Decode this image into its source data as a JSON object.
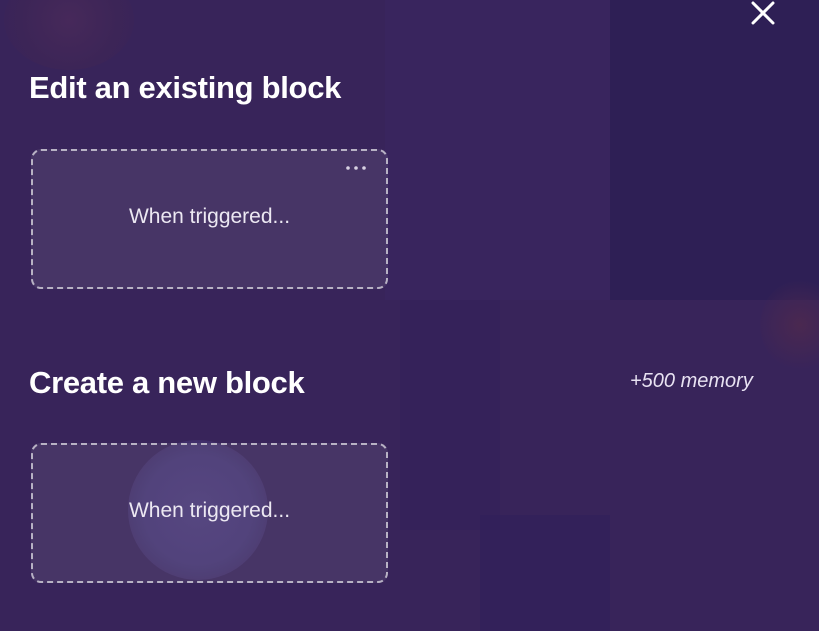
{
  "dialog": {
    "close_icon": "close-icon"
  },
  "edit_section": {
    "title": "Edit an existing block",
    "card_text": "When triggered...",
    "more_icon": "more-horizontal-icon"
  },
  "create_section": {
    "title": "Create a new block",
    "memory_note": "+500 memory",
    "card_text": "When triggered..."
  },
  "colors": {
    "background": "#38245a",
    "card_border": "#b8b2c4",
    "text": "#ffffff"
  }
}
